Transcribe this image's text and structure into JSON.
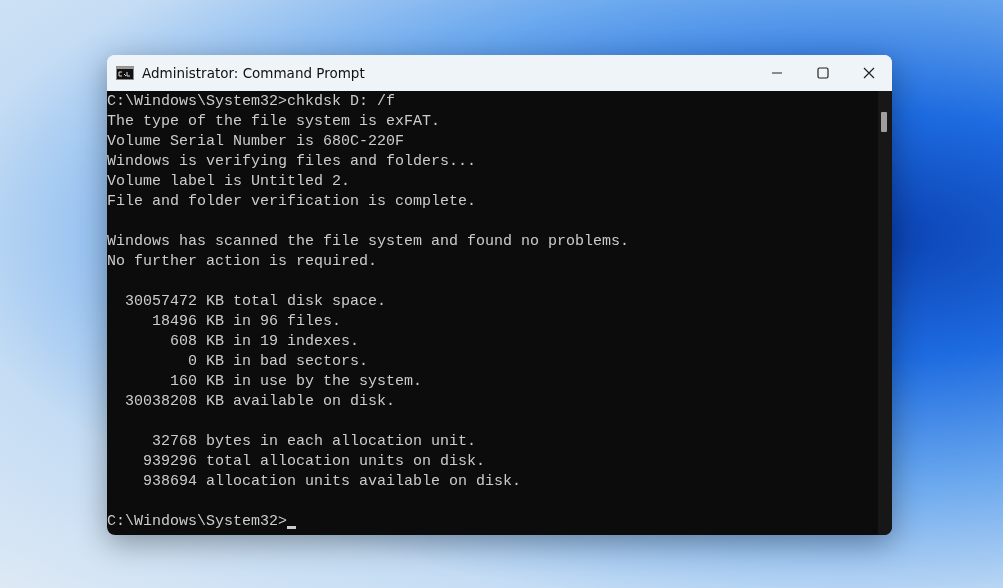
{
  "window": {
    "title": "Administrator: Command Prompt"
  },
  "console": {
    "blocks": [
      [
        "C:\\Windows\\System32>chkdsk D: /f",
        "The type of the file system is exFAT.",
        "Volume Serial Number is 680C-220F",
        "Windows is verifying files and folders...",
        "Volume label is Untitled 2.",
        "File and folder verification is complete."
      ],
      [
        "Windows has scanned the file system and found no problems.",
        "No further action is required."
      ],
      [
        "  30057472 KB total disk space.",
        "     18496 KB in 96 files.",
        "       608 KB in 19 indexes.",
        "         0 KB in bad sectors.",
        "       160 KB in use by the system.",
        "  30038208 KB available on disk."
      ],
      [
        "     32768 bytes in each allocation unit.",
        "    939296 total allocation units on disk.",
        "    938694 allocation units available on disk."
      ]
    ],
    "prompt": "C:\\Windows\\System32>"
  }
}
